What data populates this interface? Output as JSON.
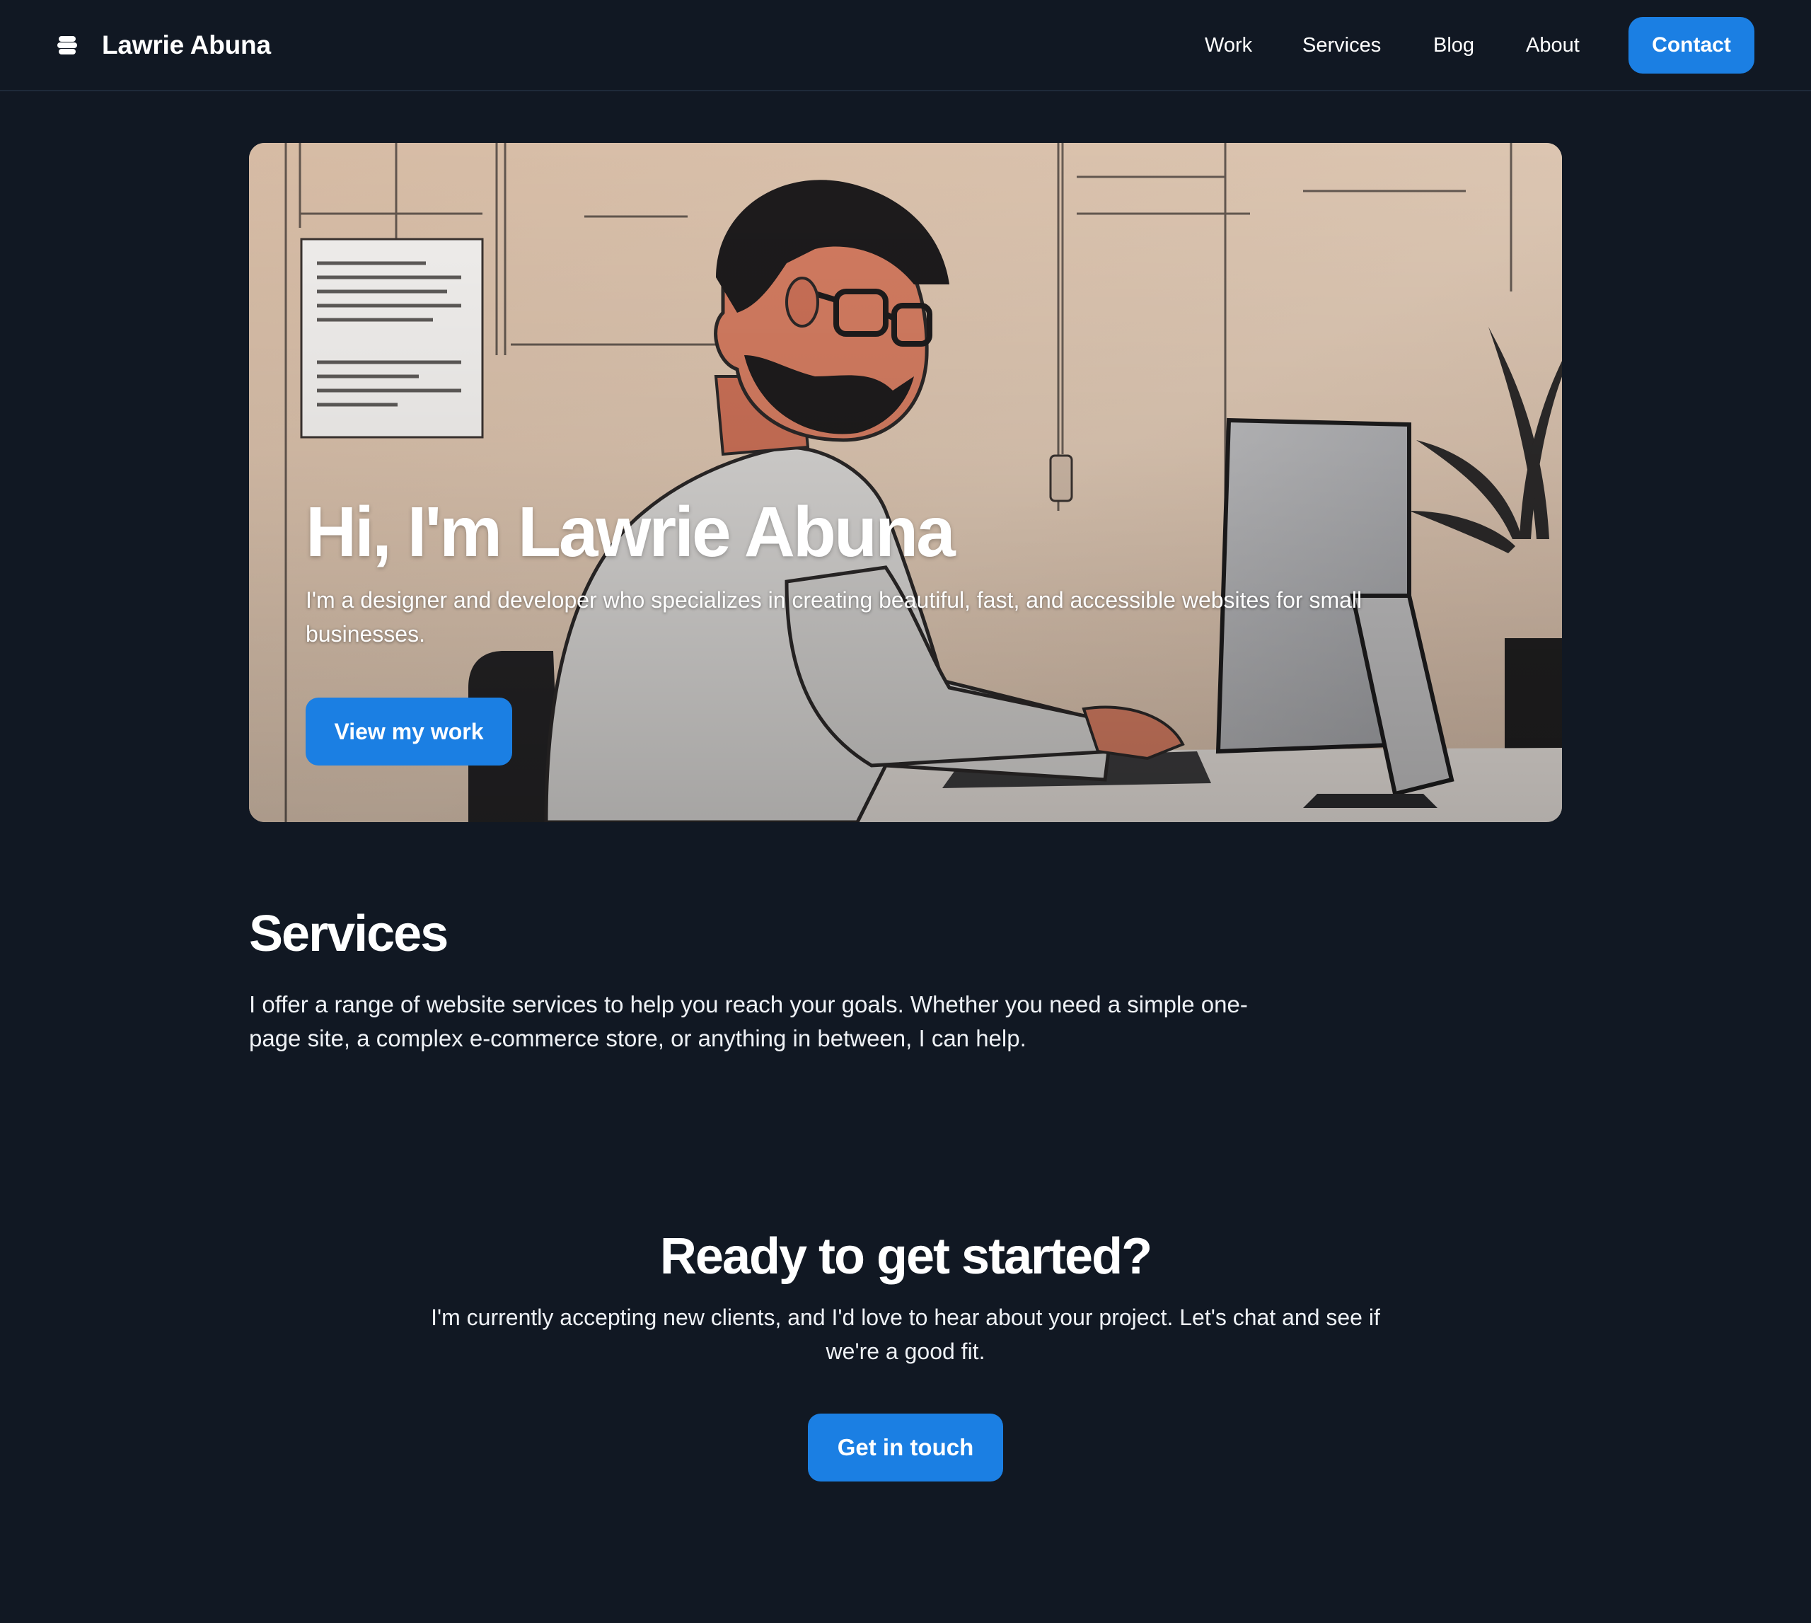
{
  "header": {
    "brand_name": "Lawrie Abuna",
    "brand_icon": "layers-icon",
    "nav": [
      {
        "label": "Work"
      },
      {
        "label": "Services"
      },
      {
        "label": "Blog"
      },
      {
        "label": "About"
      }
    ],
    "contact_label": "Contact"
  },
  "hero": {
    "title": "Hi, I'm Lawrie Abuna",
    "text": "I'm a designer and developer who specializes in creating beautiful, fast, and accessible websites for small businesses.",
    "button_label": "View my work",
    "image": "illustration-man-working-at-computer"
  },
  "services": {
    "title": "Services",
    "text": "I offer a range of website services to help you reach your goals. Whether you need a simple one-page site, a complex e-commerce store, or anything in between, I can help."
  },
  "cta": {
    "title": "Ready to get started?",
    "text": "I'm currently accepting new clients, and I'd love to hear about your project. Let's chat and see if we're a good fit.",
    "button_label": "Get in touch"
  },
  "colors": {
    "background": "#111823",
    "accent": "#1b7fe3",
    "hero_background": "#d9c3ae"
  }
}
